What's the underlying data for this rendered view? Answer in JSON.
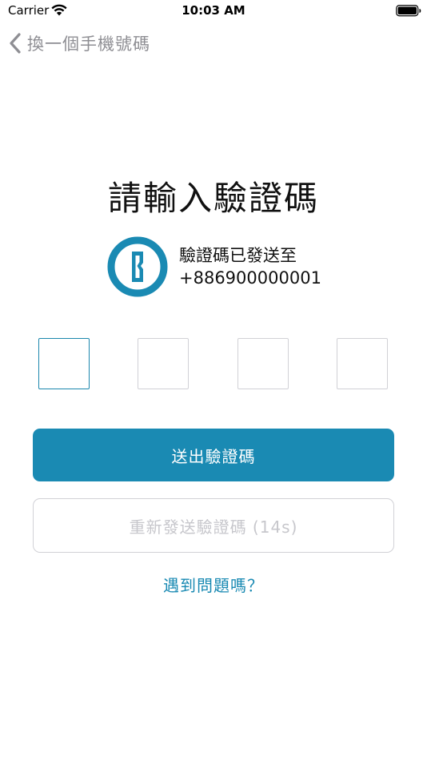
{
  "status_bar": {
    "carrier": "Carrier",
    "time": "10:03 AM",
    "icons": [
      "wifi-icon",
      "battery-icon"
    ]
  },
  "nav": {
    "back_label": "換一個手機號碼",
    "back_icon": "chevron-left-icon"
  },
  "main": {
    "title": "請輸入驗證碼",
    "sent_label": "驗證碼已發送至",
    "phone_number": "+886900000001",
    "lock_icon": "keyhole-lock-icon",
    "code_boxes": [
      "",
      "",
      "",
      ""
    ],
    "active_box_index": 0
  },
  "actions": {
    "submit_label": "送出驗證碼",
    "resend_label": "重新發送驗證碼 (14s)",
    "help_label": "遇到問題嗎？"
  },
  "colors": {
    "accent": "#1a8ab3",
    "disabled_text": "#c7c7cc",
    "border": "#d1d1d6",
    "back_text": "#8e8e93"
  }
}
